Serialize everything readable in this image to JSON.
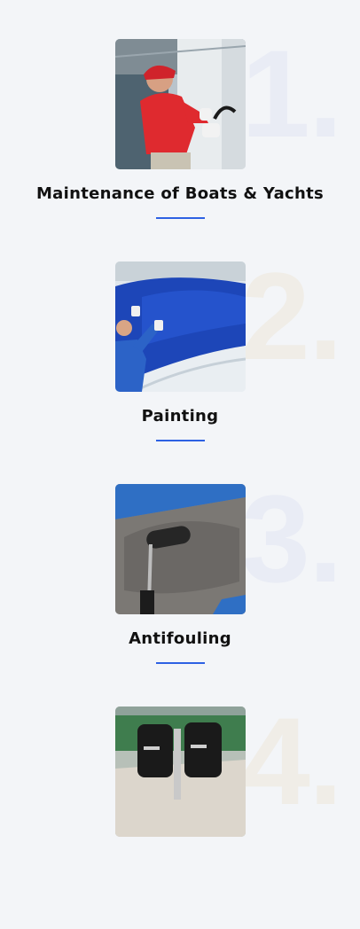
{
  "services": [
    {
      "number": "1.",
      "title": "Maintenance of Boats & Yachts",
      "image": "boat-maintenance-photo"
    },
    {
      "number": "2.",
      "title": "Painting",
      "image": "hull-painting-photo"
    },
    {
      "number": "3.",
      "title": "Antifouling",
      "image": "antifouling-roller-photo"
    },
    {
      "number": "4.",
      "title": "",
      "image": "outboard-engines-photo"
    }
  ],
  "colors": {
    "accent": "#2d61e3",
    "background": "#f3f5f8"
  }
}
